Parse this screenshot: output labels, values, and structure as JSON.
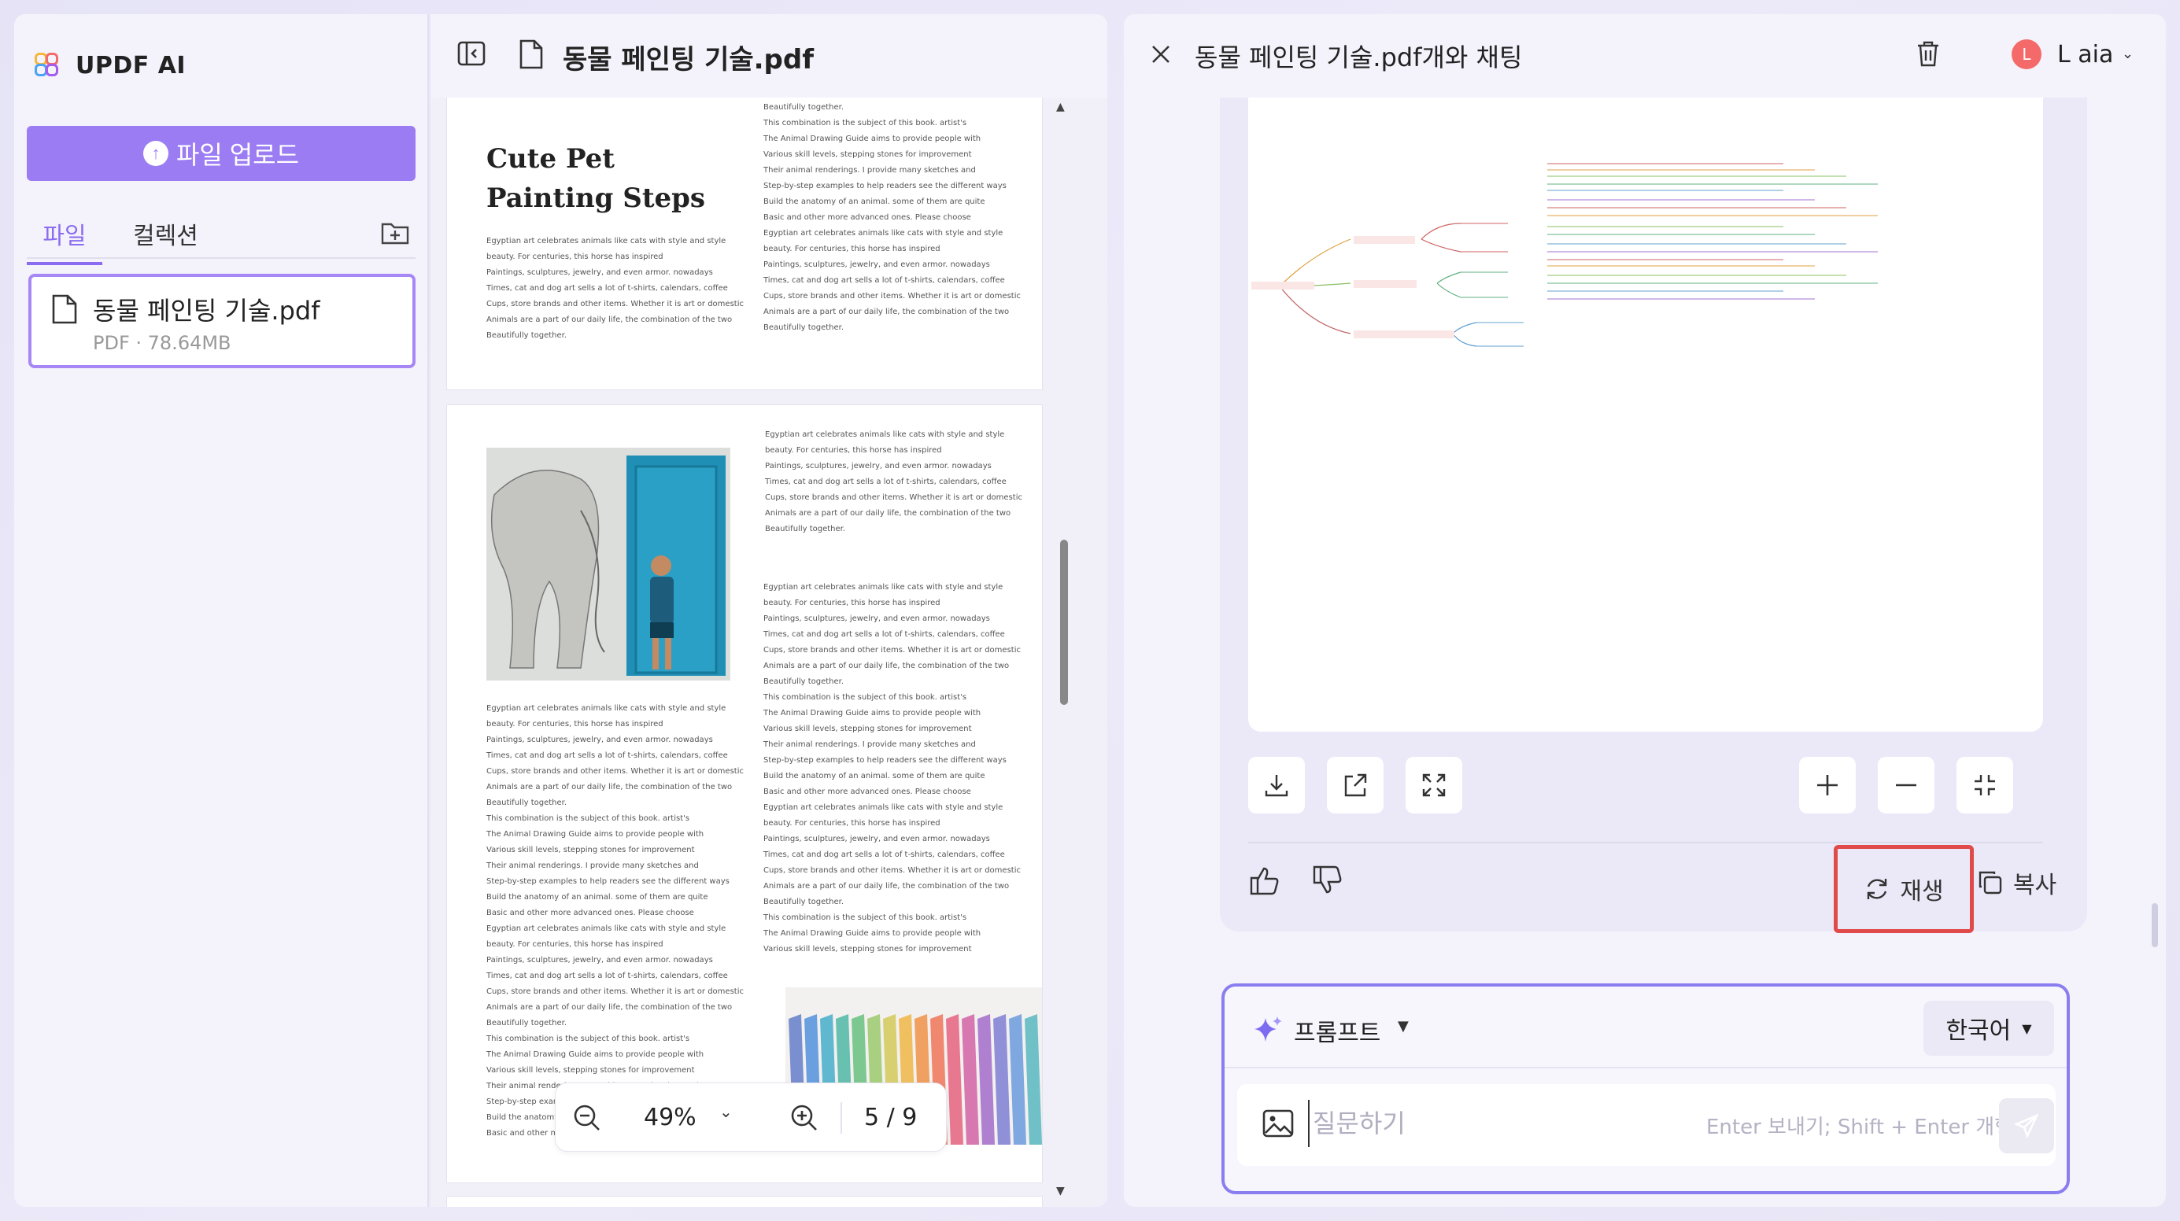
{
  "app": {
    "name": "UPDF AI"
  },
  "sidebar": {
    "upload_label": "파일 업로드",
    "tabs": [
      {
        "label": "파일",
        "active": true
      },
      {
        "label": "컬렉션",
        "active": false
      }
    ],
    "file": {
      "name": "동물 페인팅 기술.pdf",
      "meta": "PDF · 78.64MB"
    }
  },
  "document": {
    "title": "동물 페인팅 기술.pdf",
    "page_heading": "Cute Pet Painting Steps",
    "zoom": "49%",
    "page_indicator": "5 / 9",
    "body_lines": [
      "Egyptian art celebrates animals like cats with style and style",
      "beauty. For centuries, this horse has inspired",
      "Paintings, sculptures, jewelry, and even armor. nowadays",
      "Times, cat and dog art sells a lot of t-shirts, calendars, coffee",
      "Cups, store brands and other items. Whether it is art or domestic",
      "Animals are a part of our daily life, the combination of the two",
      "Beautifully together.",
      "This combination is the subject of this book. artist's",
      "The Animal Drawing Guide aims to provide people with",
      "Various skill levels, stepping stones for improvement",
      "Their animal renderings. I provide many sketches and",
      "Step-by-step examples to help readers see the different ways",
      "Build the anatomy of an animal. some of them are quite",
      "Basic and other more advanced ones. Please choose"
    ]
  },
  "chat": {
    "title": "동물 페인팅 기술.pdf개와 채팅",
    "user": {
      "initial": "L",
      "name": "L aia"
    },
    "regenerate_label": "재생",
    "copy_label": "복사",
    "prompt_label": "프롬프트",
    "language": "한국어",
    "input_placeholder": "질문하기",
    "enter_hint": "Enter 보내기; Shift + Enter 개행"
  },
  "colors": {
    "accent": "#9b7cf3",
    "highlight": "#e04a4a",
    "avatar": "#f46a6a"
  }
}
